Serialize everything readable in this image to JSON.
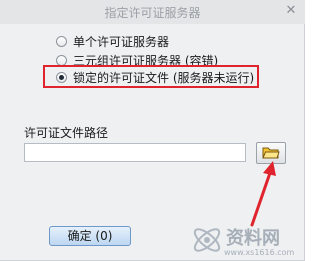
{
  "window": {
    "title": "指定许可证服务器",
    "close_glyph": "✕"
  },
  "server_options": [
    {
      "label": "单个许可证服务器",
      "selected": false
    },
    {
      "label": "三元组许可证服务器 (容错)",
      "selected": false
    },
    {
      "label": "锁定的许可证文件 (服务器未运行)",
      "selected": true
    }
  ],
  "license_path": {
    "label": "许可证文件路径",
    "value": "",
    "browse_icon": "folder-icon"
  },
  "buttons": {
    "ok_label": "确定 (0)"
  },
  "annotation": {
    "highlight_color": "#e0242e",
    "arrow_color": "#e0242e"
  },
  "watermark": {
    "text": "资料网",
    "url": "www.xs1616.com"
  }
}
